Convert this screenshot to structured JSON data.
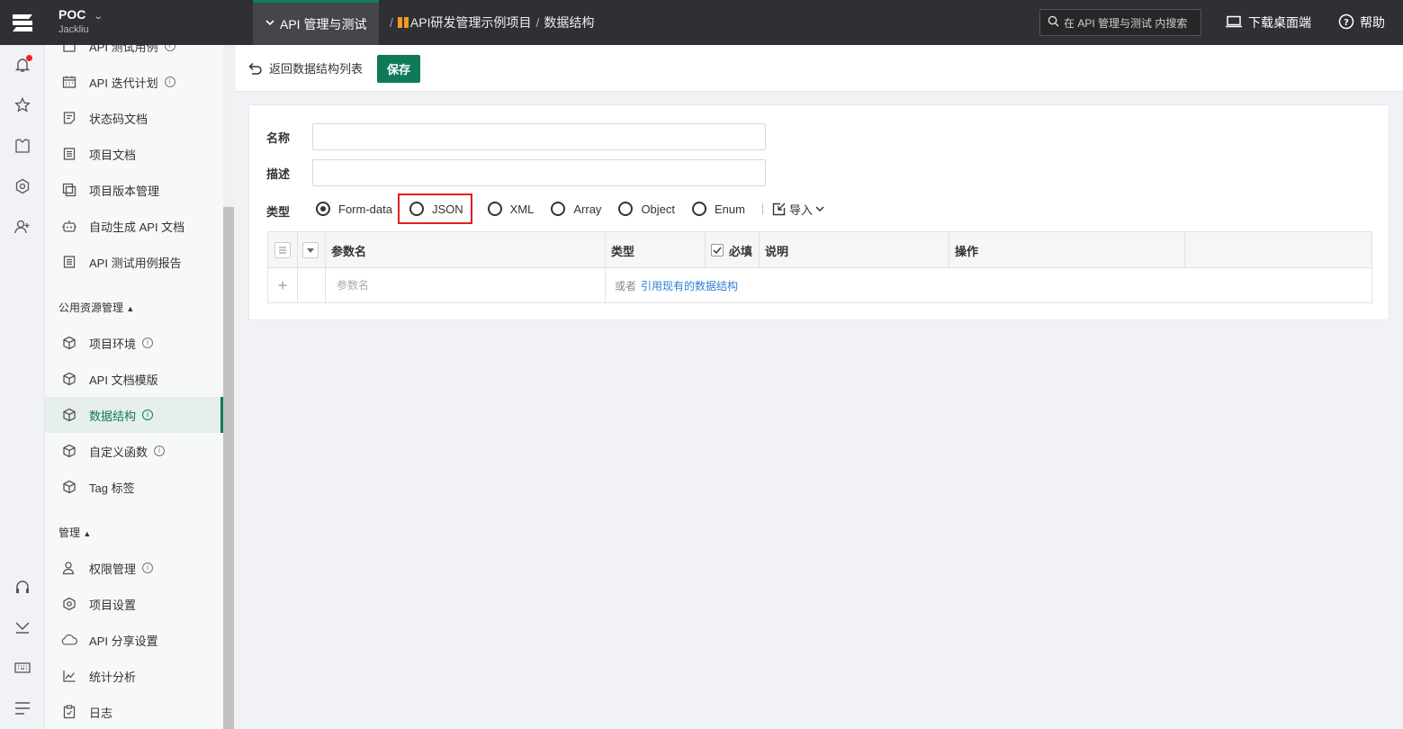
{
  "topbar": {
    "workspace_name": "POC",
    "workspace_user": "Jackliu",
    "module_label": "API 管理与测试",
    "breadcrumb": [
      "API研发管理示例项目",
      "数据结构"
    ],
    "search_placeholder": "在 API 管理与测试 内搜索",
    "download_label": "下载桌面端",
    "help_label": "帮助"
  },
  "sidebar": {
    "items_top": [
      {
        "label": "API 测试用例",
        "icon": "list-check-icon",
        "info": true
      },
      {
        "label": "API 迭代计划",
        "icon": "calendar-icon",
        "info": true
      },
      {
        "label": "状态码文档",
        "icon": "doc-icon",
        "info": false
      },
      {
        "label": "项目文档",
        "icon": "doc-lines-icon",
        "info": false
      },
      {
        "label": "项目版本管理",
        "icon": "copy-icon",
        "info": false
      },
      {
        "label": "自动生成 API 文档",
        "icon": "robot-icon",
        "info": false
      },
      {
        "label": "API 测试用例报告",
        "icon": "report-icon",
        "info": false
      }
    ],
    "group_public": "公用资源管理",
    "items_public": [
      {
        "label": "项目环境",
        "icon": "cube-icon",
        "info": true
      },
      {
        "label": "API 文档模版",
        "icon": "cube-icon",
        "info": false
      },
      {
        "label": "数据结构",
        "icon": "cube-icon",
        "info": true,
        "active": true
      },
      {
        "label": "自定义函数",
        "icon": "cube-icon",
        "info": true
      },
      {
        "label": "Tag 标签",
        "icon": "cube-icon",
        "info": false
      }
    ],
    "group_manage": "管理",
    "items_manage": [
      {
        "label": "权限管理",
        "icon": "users-icon",
        "info": true
      },
      {
        "label": "项目设置",
        "icon": "gear-icon",
        "info": false
      },
      {
        "label": "API 分享设置",
        "icon": "cloud-icon",
        "info": false
      },
      {
        "label": "统计分析",
        "icon": "chart-icon",
        "info": false
      },
      {
        "label": "日志",
        "icon": "clipboard-icon",
        "info": false
      }
    ]
  },
  "toolbar": {
    "back_label": "返回数据结构列表",
    "save_label": "保存"
  },
  "form": {
    "name_label": "名称",
    "name_value": "",
    "desc_label": "描述",
    "desc_value": "",
    "type_label": "类型",
    "types": [
      "Form-data",
      "JSON",
      "XML",
      "Array",
      "Object",
      "Enum"
    ],
    "selected_type": "Form-data",
    "highlighted_type": "JSON",
    "import_label": "导入"
  },
  "table": {
    "headers": [
      "参数名",
      "类型",
      "必填",
      "说明",
      "操作"
    ],
    "param_placeholder": "参数名",
    "or_text": "或者",
    "ref_link": "引用现有的数据结构"
  },
  "colors": {
    "brand": "#0f7a5a",
    "topbar": "#2f3033",
    "highlight": "#e02020",
    "link": "#2b7fd8"
  }
}
